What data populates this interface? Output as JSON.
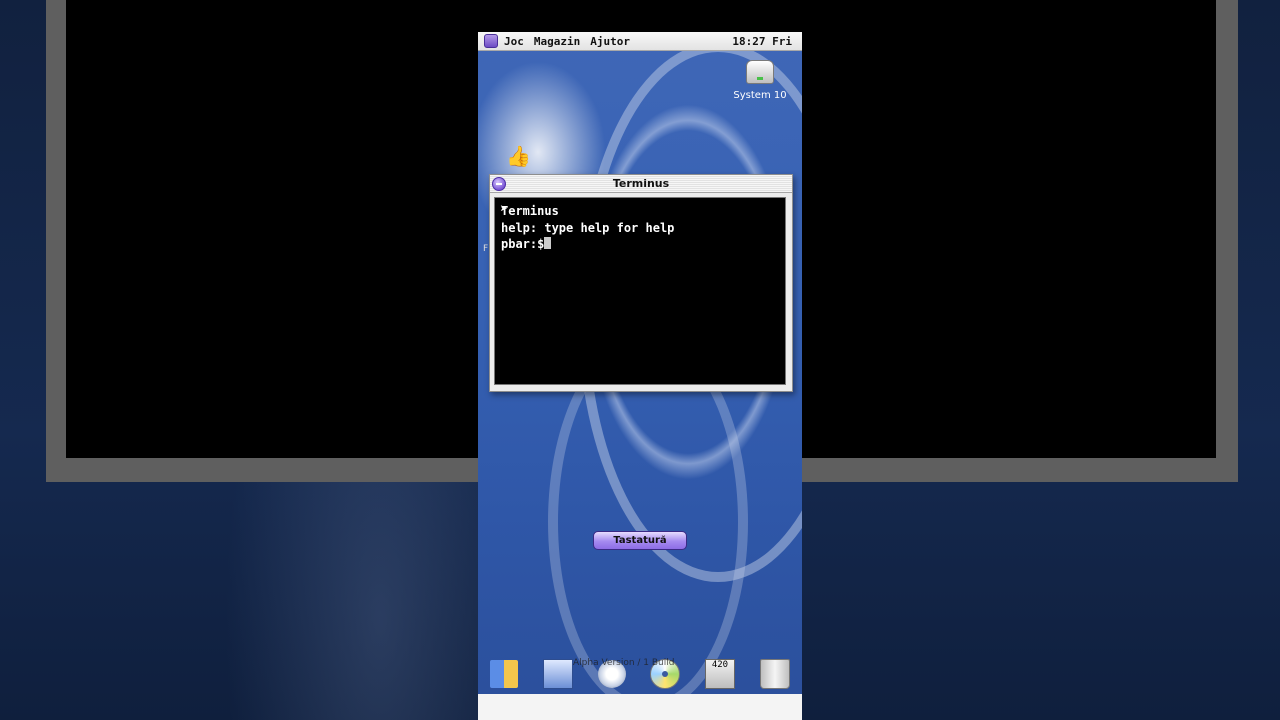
{
  "menubar": {
    "items": [
      "Joc",
      "Magazin",
      "Ajutor"
    ],
    "clock": "18:27 Fri"
  },
  "desktop": {
    "drive_label": "System 10",
    "side_letter": "F"
  },
  "terminal": {
    "title": "Terminus",
    "lines": [
      "Terminus",
      "help: type help for help",
      "pbar:$"
    ]
  },
  "keyboard_button": "Tastatură",
  "dock": {
    "overlay_text": "Alpha Version / 1 Build",
    "calc_label": "420",
    "icons": [
      "finder-icon",
      "mail-icon",
      "game-controller-icon",
      "disc-icon",
      "calculator-icon",
      "trash-icon"
    ]
  },
  "colors": {
    "desktop_blue": "#3661b3",
    "accent_purple": "#8d6de6"
  }
}
